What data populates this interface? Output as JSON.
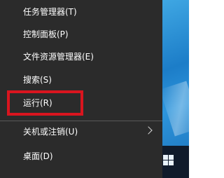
{
  "menu": {
    "items": [
      {
        "label": "任务管理器(T)"
      },
      {
        "label": "控制面板(P)"
      },
      {
        "label": "文件资源管理器(E)"
      },
      {
        "label": "搜索(S)"
      },
      {
        "label": "运行(R)"
      },
      {
        "label": "关机或注销(U)"
      },
      {
        "label": "桌面(D)"
      }
    ]
  },
  "colors": {
    "menu_background": "#2b2b2b",
    "menu_text": "#ffffff",
    "highlight_border": "#d9151f",
    "desktop_blue": "#2a8fd6"
  },
  "icons": {
    "submenu_arrow": "chevron-right-icon",
    "start": "windows-logo-icon"
  }
}
